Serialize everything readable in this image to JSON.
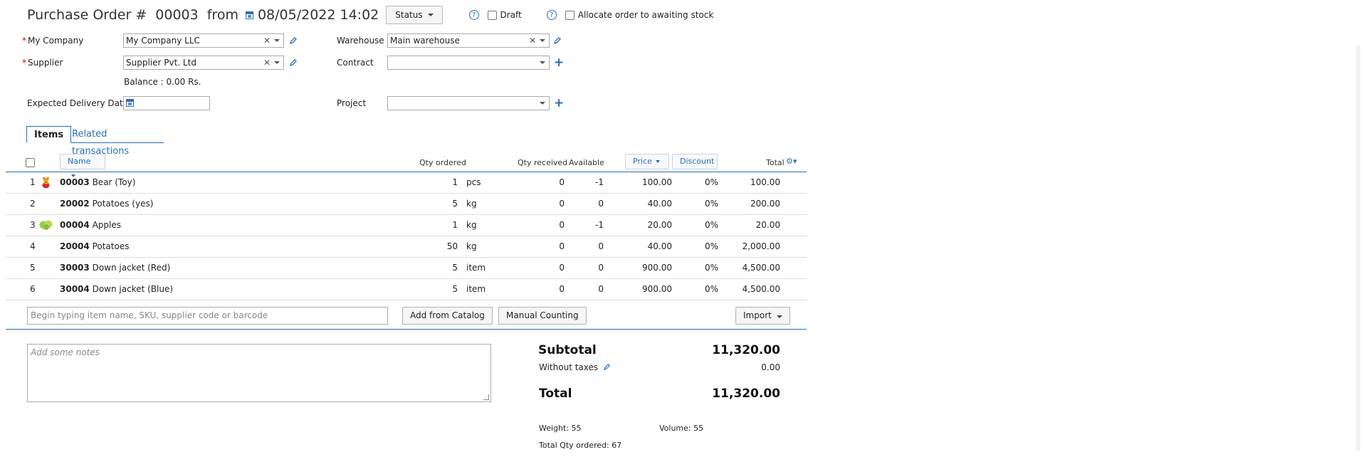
{
  "header": {
    "title": "Purchase Order #",
    "number": "00003",
    "from_label": "from",
    "date": "08/05/2022 14:02",
    "status_label": "Status",
    "draft_label": "Draft",
    "allocate_label": "Allocate order to awaiting stock"
  },
  "form": {
    "my_company_label": "My Company",
    "my_company_value": "My Company LLC",
    "supplier_label": "Supplier",
    "supplier_value": "Supplier Pvt. Ltd",
    "balance": "Balance : 0.00 Rs.",
    "expected_delivery_label": "Expected Delivery Date",
    "warehouse_label": "Warehouse",
    "warehouse_value": "Main warehouse",
    "contract_label": "Contract",
    "contract_value": "",
    "project_label": "Project",
    "project_value": ""
  },
  "tabs": [
    {
      "label": "Items",
      "active": true
    },
    {
      "label": "Related transactions",
      "active": false
    }
  ],
  "columns": {
    "name": "Name",
    "qty_ordered": "Qty ordered",
    "qty_received": "Qty received",
    "available": "Available",
    "price": "Price",
    "discount": "Discount",
    "total": "Total"
  },
  "rows": [
    {
      "num": "1",
      "sku": "00003",
      "name": "Bear (Toy)",
      "qty": "1",
      "unit": "pcs",
      "received": "0",
      "available": "-1",
      "price": "100.00",
      "discount": "0%",
      "total": "100.00",
      "icon": "bear-toy-icon"
    },
    {
      "num": "2",
      "sku": "20002",
      "name": "Potatoes (yes)",
      "qty": "5",
      "unit": "kg",
      "received": "0",
      "available": "0",
      "price": "40.00",
      "discount": "0%",
      "total": "200.00",
      "icon": ""
    },
    {
      "num": "3",
      "sku": "00004",
      "name": "Apples",
      "qty": "1",
      "unit": "kg",
      "received": "0",
      "available": "-1",
      "price": "20.00",
      "discount": "0%",
      "total": "20.00",
      "icon": "apples-icon"
    },
    {
      "num": "4",
      "sku": "20004",
      "name": "Potatoes",
      "qty": "50",
      "unit": "kg",
      "received": "0",
      "available": "0",
      "price": "40.00",
      "discount": "0%",
      "total": "2,000.00",
      "icon": ""
    },
    {
      "num": "5",
      "sku": "30003",
      "name": "Down jacket (Red)",
      "qty": "5",
      "unit": "item",
      "received": "0",
      "available": "0",
      "price": "900.00",
      "discount": "0%",
      "total": "4,500.00",
      "icon": ""
    },
    {
      "num": "6",
      "sku": "30004",
      "name": "Down jacket (Blue)",
      "qty": "5",
      "unit": "item",
      "received": "0",
      "available": "0",
      "price": "900.00",
      "discount": "0%",
      "total": "4,500.00",
      "icon": ""
    }
  ],
  "add_bar": {
    "placeholder": "Begin typing item name, SKU, supplier code or barcode",
    "add_from_catalog": "Add from Catalog",
    "manual_counting": "Manual Counting",
    "import": "Import"
  },
  "notes": {
    "placeholder": "Add some notes"
  },
  "summary": {
    "subtotal_label": "Subtotal",
    "subtotal_value": "11,320.00",
    "without_taxes_label": "Without taxes",
    "without_taxes_value": "0.00",
    "total_label": "Total",
    "total_value": "11,320.00",
    "weight": "Weight: 55",
    "volume": "Volume: 55",
    "total_qty": "Total Qty ordered: 67"
  },
  "colors": {
    "accent": "#2a6fb0",
    "required": "#cc0000"
  }
}
